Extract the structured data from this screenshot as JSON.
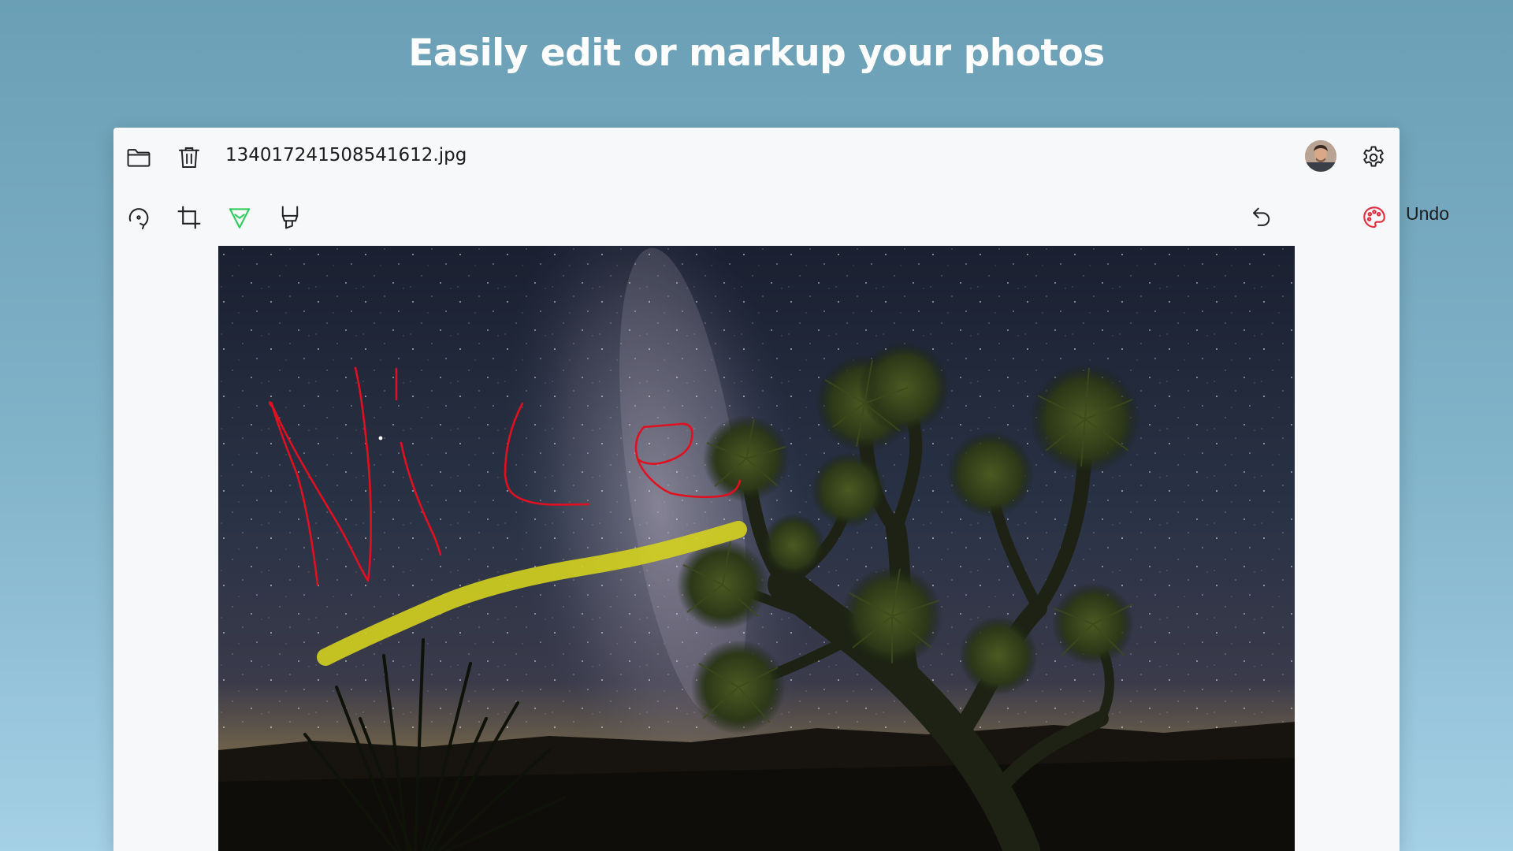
{
  "headline": "Easily edit or markup your photos",
  "file": {
    "name": "134017241508541612.jpg"
  },
  "topbar": {
    "open_icon": "folder-icon",
    "delete_icon": "trash-icon",
    "account_icon": "avatar",
    "settings_icon": "gear-icon"
  },
  "toolbar": {
    "rotate_icon": "rotate-icon",
    "crop_icon": "crop-icon",
    "pen_icon": "pen-icon",
    "highlighter_icon": "highlighter-icon",
    "undo_icon": "undo-icon",
    "undo_label": "Undo",
    "color_icon": "palette-icon"
  },
  "colors": {
    "accent_pen": "#2ecc5b",
    "palette": "#e03040",
    "ink_red": "#e01020",
    "ink_yellow": "#d4d21f"
  },
  "canvas": {
    "annotation_text": "Nice"
  }
}
